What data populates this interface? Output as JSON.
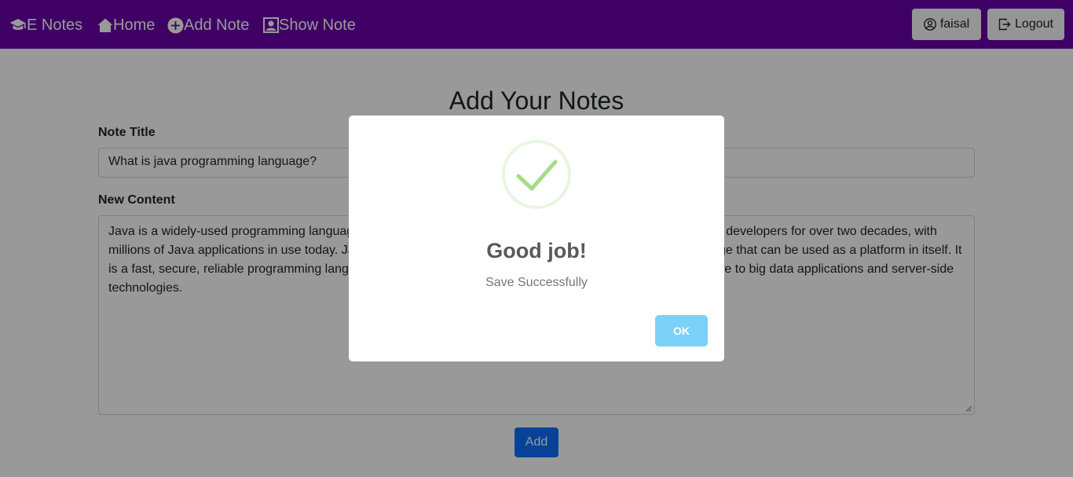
{
  "nav": {
    "brand": "E Notes",
    "links": [
      {
        "label": "Home",
        "icon": "home-icon"
      },
      {
        "label": "Add Note",
        "icon": "plus-circle-icon"
      },
      {
        "label": "Show Note",
        "icon": "person-square-icon"
      }
    ],
    "user": {
      "label": "faisal",
      "icon": "user-circle-icon"
    },
    "logout": {
      "label": "Logout",
      "icon": "logout-icon"
    },
    "color": "#6a00a8"
  },
  "main": {
    "title": "Add Your Notes",
    "note_title_label": "Note Title",
    "note_title_value": "What is java programming language?",
    "content_label": "New Content",
    "content_value": "Java is a widely-used programming language for coding web applications. It has been a popular choice among developers for over two decades, with millions of Java applications in use today. Java is a multi-platform, object-oriented, and network-centric language that can be used as a platform in itself. It is a fast, secure, reliable programming language for coding everything from mobile apps and enterprise software to big data applications and server-side technologies.",
    "add_button": "Add",
    "add_button_color": "#0d6efd"
  },
  "modal": {
    "icon": "success-check-icon",
    "title": "Good job!",
    "text": "Save Successfully",
    "ok_button": "OK",
    "ok_color": "#7cd1f9",
    "check_color": "#a5dc86"
  }
}
